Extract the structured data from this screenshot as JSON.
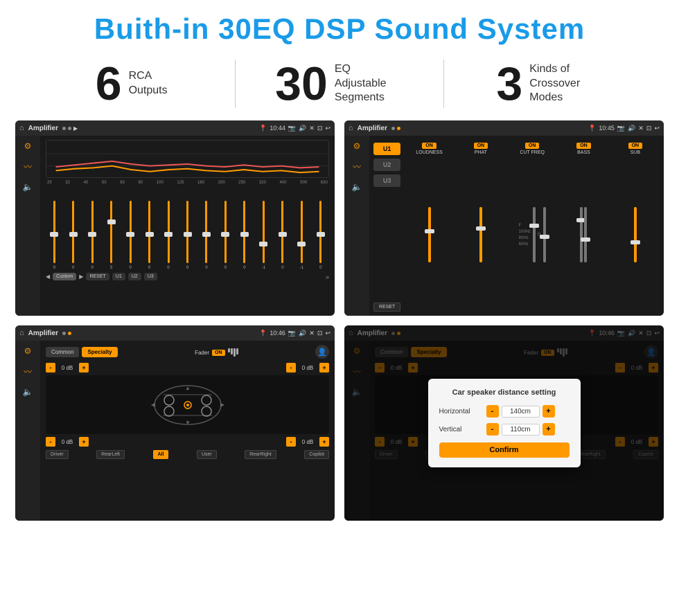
{
  "header": {
    "title": "Buith-in 30EQ DSP Sound System"
  },
  "stats": [
    {
      "number": "6",
      "label_line1": "RCA",
      "label_line2": "Outputs"
    },
    {
      "number": "30",
      "label_line1": "EQ Adjustable",
      "label_line2": "Segments"
    },
    {
      "number": "3",
      "label_line1": "Kinds of",
      "label_line2": "Crossover Modes"
    }
  ],
  "screens": [
    {
      "id": "screen1",
      "time": "10:44",
      "title": "Amplifier",
      "type": "eq"
    },
    {
      "id": "screen2",
      "time": "10:45",
      "title": "Amplifier",
      "type": "crossover"
    },
    {
      "id": "screen3",
      "time": "10:46",
      "title": "Amplifier",
      "type": "speaker"
    },
    {
      "id": "screen4",
      "time": "10:46",
      "title": "Amplifier",
      "type": "speaker-dialog"
    }
  ],
  "eq": {
    "bands": [
      "25",
      "32",
      "40",
      "50",
      "63",
      "80",
      "100",
      "125",
      "160",
      "200",
      "250",
      "320",
      "400",
      "500",
      "630"
    ],
    "values": [
      "0",
      "0",
      "0",
      "5",
      "0",
      "0",
      "0",
      "0",
      "0",
      "0",
      "0",
      "-1",
      "0",
      "-1"
    ],
    "thumbPositions": [
      50,
      50,
      50,
      30,
      50,
      50,
      50,
      50,
      50,
      50,
      50,
      65,
      50,
      65,
      50
    ],
    "preset": "Custom",
    "buttons": [
      "U1",
      "U2",
      "U3"
    ]
  },
  "crossover": {
    "channels": [
      "U1",
      "U2",
      "U3"
    ],
    "cols": [
      {
        "label": "LOUDNESS",
        "on": true
      },
      {
        "label": "PHAT",
        "on": true
      },
      {
        "label": "CUT FREQ",
        "on": true
      },
      {
        "label": "BASS",
        "on": true
      },
      {
        "label": "SUB",
        "on": true
      }
    ],
    "reset": "RESET"
  },
  "speaker": {
    "tabs": [
      "Common",
      "Specialty"
    ],
    "active_tab": "Specialty",
    "fader_label": "Fader",
    "fader_on": "ON",
    "db_values": [
      "0 dB",
      "0 dB",
      "0 dB",
      "0 dB"
    ],
    "bottom_buttons": [
      "Driver",
      "RearLeft",
      "All",
      "User",
      "RearRight",
      "Copilot"
    ]
  },
  "dialog": {
    "title": "Car speaker distance setting",
    "horizontal_label": "Horizontal",
    "horizontal_value": "140cm",
    "vertical_label": "Vertical",
    "vertical_value": "110cm",
    "confirm_label": "Confirm"
  }
}
